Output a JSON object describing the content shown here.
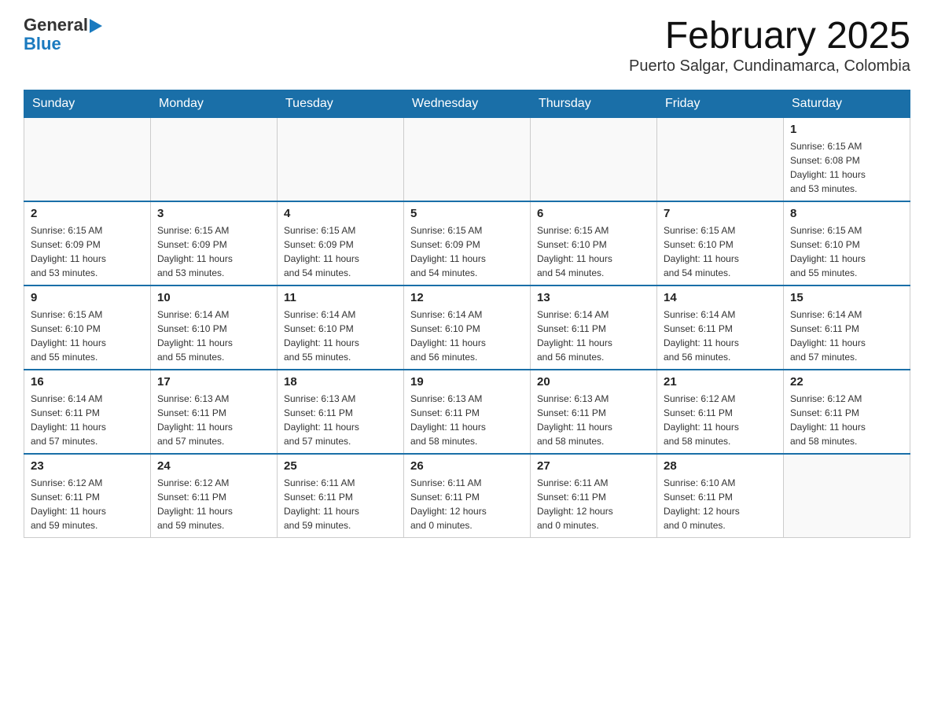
{
  "header": {
    "logo": {
      "general": "General",
      "arrow": "▶",
      "blue": "Blue"
    },
    "title": "February 2025",
    "subtitle": "Puerto Salgar, Cundinamarca, Colombia"
  },
  "weekdays": [
    "Sunday",
    "Monday",
    "Tuesday",
    "Wednesday",
    "Thursday",
    "Friday",
    "Saturday"
  ],
  "weeks": [
    [
      {
        "day": "",
        "info": ""
      },
      {
        "day": "",
        "info": ""
      },
      {
        "day": "",
        "info": ""
      },
      {
        "day": "",
        "info": ""
      },
      {
        "day": "",
        "info": ""
      },
      {
        "day": "",
        "info": ""
      },
      {
        "day": "1",
        "info": "Sunrise: 6:15 AM\nSunset: 6:08 PM\nDaylight: 11 hours\nand 53 minutes."
      }
    ],
    [
      {
        "day": "2",
        "info": "Sunrise: 6:15 AM\nSunset: 6:09 PM\nDaylight: 11 hours\nand 53 minutes."
      },
      {
        "day": "3",
        "info": "Sunrise: 6:15 AM\nSunset: 6:09 PM\nDaylight: 11 hours\nand 53 minutes."
      },
      {
        "day": "4",
        "info": "Sunrise: 6:15 AM\nSunset: 6:09 PM\nDaylight: 11 hours\nand 54 minutes."
      },
      {
        "day": "5",
        "info": "Sunrise: 6:15 AM\nSunset: 6:09 PM\nDaylight: 11 hours\nand 54 minutes."
      },
      {
        "day": "6",
        "info": "Sunrise: 6:15 AM\nSunset: 6:10 PM\nDaylight: 11 hours\nand 54 minutes."
      },
      {
        "day": "7",
        "info": "Sunrise: 6:15 AM\nSunset: 6:10 PM\nDaylight: 11 hours\nand 54 minutes."
      },
      {
        "day": "8",
        "info": "Sunrise: 6:15 AM\nSunset: 6:10 PM\nDaylight: 11 hours\nand 55 minutes."
      }
    ],
    [
      {
        "day": "9",
        "info": "Sunrise: 6:15 AM\nSunset: 6:10 PM\nDaylight: 11 hours\nand 55 minutes."
      },
      {
        "day": "10",
        "info": "Sunrise: 6:14 AM\nSunset: 6:10 PM\nDaylight: 11 hours\nand 55 minutes."
      },
      {
        "day": "11",
        "info": "Sunrise: 6:14 AM\nSunset: 6:10 PM\nDaylight: 11 hours\nand 55 minutes."
      },
      {
        "day": "12",
        "info": "Sunrise: 6:14 AM\nSunset: 6:10 PM\nDaylight: 11 hours\nand 56 minutes."
      },
      {
        "day": "13",
        "info": "Sunrise: 6:14 AM\nSunset: 6:11 PM\nDaylight: 11 hours\nand 56 minutes."
      },
      {
        "day": "14",
        "info": "Sunrise: 6:14 AM\nSunset: 6:11 PM\nDaylight: 11 hours\nand 56 minutes."
      },
      {
        "day": "15",
        "info": "Sunrise: 6:14 AM\nSunset: 6:11 PM\nDaylight: 11 hours\nand 57 minutes."
      }
    ],
    [
      {
        "day": "16",
        "info": "Sunrise: 6:14 AM\nSunset: 6:11 PM\nDaylight: 11 hours\nand 57 minutes."
      },
      {
        "day": "17",
        "info": "Sunrise: 6:13 AM\nSunset: 6:11 PM\nDaylight: 11 hours\nand 57 minutes."
      },
      {
        "day": "18",
        "info": "Sunrise: 6:13 AM\nSunset: 6:11 PM\nDaylight: 11 hours\nand 57 minutes."
      },
      {
        "day": "19",
        "info": "Sunrise: 6:13 AM\nSunset: 6:11 PM\nDaylight: 11 hours\nand 58 minutes."
      },
      {
        "day": "20",
        "info": "Sunrise: 6:13 AM\nSunset: 6:11 PM\nDaylight: 11 hours\nand 58 minutes."
      },
      {
        "day": "21",
        "info": "Sunrise: 6:12 AM\nSunset: 6:11 PM\nDaylight: 11 hours\nand 58 minutes."
      },
      {
        "day": "22",
        "info": "Sunrise: 6:12 AM\nSunset: 6:11 PM\nDaylight: 11 hours\nand 58 minutes."
      }
    ],
    [
      {
        "day": "23",
        "info": "Sunrise: 6:12 AM\nSunset: 6:11 PM\nDaylight: 11 hours\nand 59 minutes."
      },
      {
        "day": "24",
        "info": "Sunrise: 6:12 AM\nSunset: 6:11 PM\nDaylight: 11 hours\nand 59 minutes."
      },
      {
        "day": "25",
        "info": "Sunrise: 6:11 AM\nSunset: 6:11 PM\nDaylight: 11 hours\nand 59 minutes."
      },
      {
        "day": "26",
        "info": "Sunrise: 6:11 AM\nSunset: 6:11 PM\nDaylight: 12 hours\nand 0 minutes."
      },
      {
        "day": "27",
        "info": "Sunrise: 6:11 AM\nSunset: 6:11 PM\nDaylight: 12 hours\nand 0 minutes."
      },
      {
        "day": "28",
        "info": "Sunrise: 6:10 AM\nSunset: 6:11 PM\nDaylight: 12 hours\nand 0 minutes."
      },
      {
        "day": "",
        "info": ""
      }
    ]
  ]
}
